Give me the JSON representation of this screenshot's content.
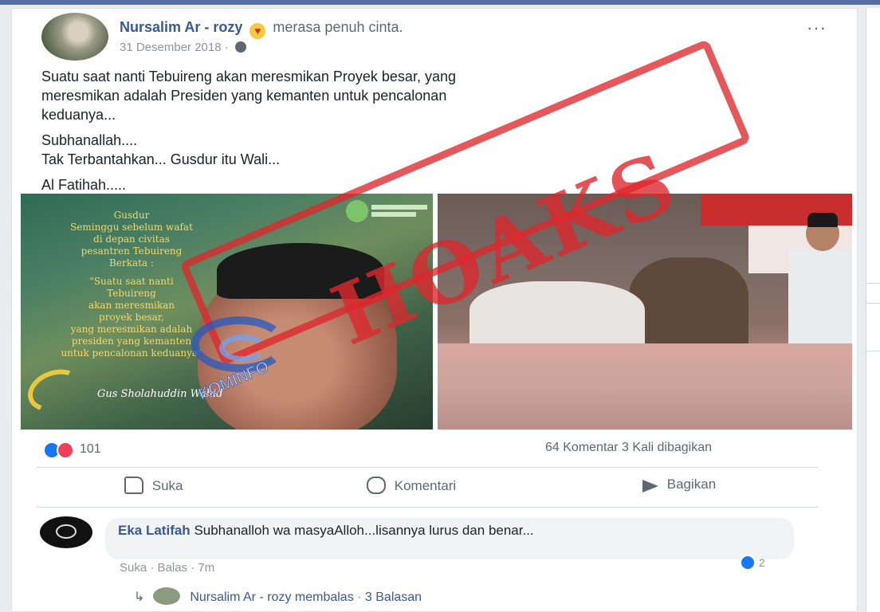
{
  "post": {
    "author": "Nursalim Ar - rozy",
    "feeling": "merasa penuh cinta.",
    "date": "31 Desember 2018 ·",
    "more": "···",
    "paragraphs": [
      "Suatu saat nanti Tebuireng akan meresmikan Proyek besar, yang\nmeresmikan adalah Presiden yang kemanten untuk pencalonan\nkeduanya...",
      "Subhanallah....\nTak Terbantahkan... Gusdur itu Wali...",
      "Al Fatihah....."
    ],
    "image_left_quote": [
      "Gusdur",
      "Seminggu sebelum wafat",
      "di depan civitas",
      "pesantren Tebuireng",
      "Berkata :",
      "",
      "\"Suatu saat nanti",
      "Tebuireng",
      "akan meresmikan",
      "proyek besar,",
      "yang meresmikan adalah",
      "presiden yang kemanten",
      "untuk pencalonan keduanya\""
    ],
    "image_left_signature": "Gus Sholahuddin Wahid",
    "stamp": "HOAKS",
    "stamp_source": "KOMINFO"
  },
  "stats": {
    "reaction_count": "101",
    "comments_shares": "64 Komentar  3 Kali dibagikan"
  },
  "actions": {
    "like": "Suka",
    "comment": "Komentari",
    "share": "Bagikan"
  },
  "comment": {
    "author": "Eka Latifah",
    "text": "Subhanalloh wa masyaAlloh...lisannya lurus dan benar...",
    "meta": "Suka · Balas · 7m",
    "like_count": "2",
    "reply_author": "Nursalim Ar - rozy membalas",
    "reply_sep": " · ",
    "reply_count": "3 Balasan"
  },
  "colors": {
    "link": "#385898",
    "like_blue": "#1877f2",
    "love_red": "#f33e58",
    "stamp_red": "#dc282d"
  }
}
